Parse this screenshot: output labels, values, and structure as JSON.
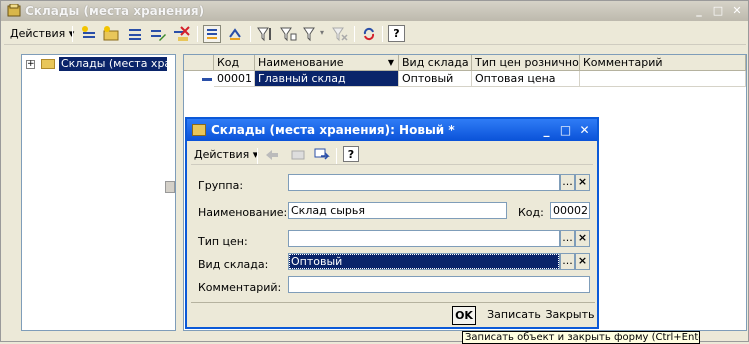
{
  "window": {
    "title": "Склады (места хранения)"
  },
  "toolbar": {
    "actions_label": "Действия",
    "help_label": "?"
  },
  "tree": {
    "root_label": "Склады (места хранения)"
  },
  "grid": {
    "columns": [
      "Код",
      "Наименование",
      "Вид склада",
      "Тип цен розничной...",
      "Комментарий"
    ],
    "rows": [
      {
        "code": "00001",
        "name": "Главный склад",
        "warehouse_type": "Оптовый",
        "price_type": "Оптовая цена",
        "comment": ""
      }
    ]
  },
  "dialog": {
    "title": "Склады (места хранения): Новый *",
    "toolbar": {
      "actions_label": "Действия",
      "help_label": "?"
    },
    "fields": {
      "group_label": "Группа:",
      "group_value": "",
      "name_label": "Наименование:",
      "name_value": "Склад сырья",
      "code_label": "Код:",
      "code_value": "00002",
      "price_type_label": "Тип цен:",
      "price_type_value": "",
      "warehouse_type_label": "Вид склада:",
      "warehouse_type_value": "Оптовый",
      "comment_label": "Комментарий:",
      "comment_value": ""
    },
    "buttons": {
      "ok": "OK",
      "save": "Записать",
      "close": "Закрыть"
    },
    "select_btn": "...",
    "clear_btn": "×"
  },
  "tooltip": {
    "text": "Записать объект и закрыть форму (Ctrl+Enter)"
  }
}
